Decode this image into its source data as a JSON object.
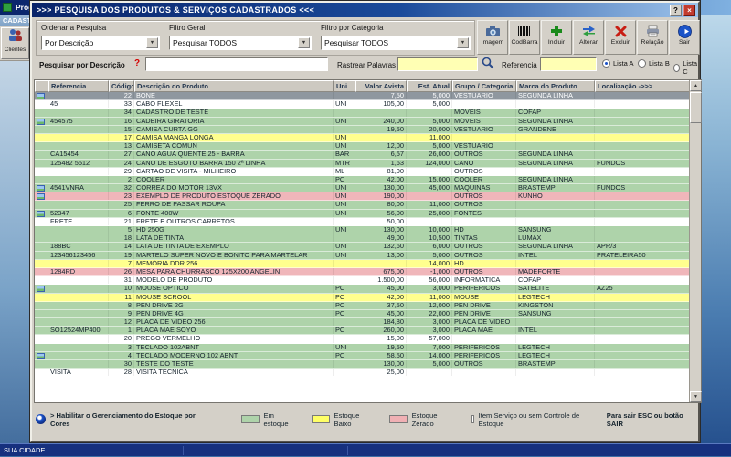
{
  "background": {
    "app_title": "Progra",
    "menu_label": "CADASTRO",
    "toolbar_button": "Clientes",
    "status_text": "SUA CIDADE"
  },
  "dialog": {
    "title": ">>>  PESQUISA DOS PRODUTOS & SERVIÇOS CADASTRADOS  <<<",
    "titlebar": {
      "help": "?",
      "close": "×"
    },
    "filters": {
      "order_label": "Ordenar a Pesquisa",
      "order_value": "Por Descrição",
      "general_label": "Filtro Geral",
      "general_value": "Pesquisar TODOS",
      "category_label": "Filtro por Categoria",
      "category_value": "Pesquisar TODOS"
    },
    "toolbar": [
      {
        "label": "Imagem",
        "icon": "camera-icon"
      },
      {
        "label": "CodBarra",
        "icon": "barcode-icon"
      },
      {
        "label": "Incluir",
        "icon": "plus-icon"
      },
      {
        "label": "Alterar",
        "icon": "edit-arrows-icon"
      },
      {
        "label": "Excluir",
        "icon": "x-icon"
      },
      {
        "label": "Relação",
        "icon": "report-icon"
      },
      {
        "label": "Sair",
        "icon": "exit-arrow-icon"
      }
    ],
    "search": {
      "desc_label": "Pesquisar por Descrição",
      "desc_hint": "?",
      "desc_value": "",
      "words_label": "Rastrear Palavras",
      "words_value": "",
      "ref_label": "Referencia",
      "ref_value": ""
    },
    "lists": [
      {
        "label": "Lista A",
        "selected": true
      },
      {
        "label": "Lista B",
        "selected": false
      },
      {
        "label": "Lista C",
        "selected": false
      }
    ],
    "table": {
      "headers": [
        "Referencia",
        "Código",
        "Descrição do Produto",
        "Uni",
        "Valor Avista",
        "Est. Atual",
        "Grupo / Categoria",
        "Marca do Produto",
        "Localização  ->>>"
      ],
      "status_colors": {
        "selected": "#8f979f",
        "ok": "#aed3aa",
        "low": "#ffff8e",
        "zero": "#f0b6ba",
        "none": "#ffffff"
      },
      "rows": [
        {
          "ref": "",
          "code": "22",
          "desc": "BONE",
          "uni": "",
          "price": "7,50",
          "stock": "5,000",
          "group": "VESTUARIO",
          "brand": "SEGUNDA LINHA",
          "loc": "",
          "status": "selected",
          "img": true
        },
        {
          "ref": "45",
          "code": "33",
          "desc": "CABO FLEXEL",
          "uni": "UNI",
          "price": "105,00",
          "stock": "5,000",
          "group": "",
          "brand": "",
          "loc": "",
          "status": "none",
          "img": false
        },
        {
          "ref": "",
          "code": "34",
          "desc": "CADASTRO DE TESTE",
          "uni": "",
          "price": "",
          "stock": "",
          "group": "MÓVEIS",
          "brand": "COFAP",
          "loc": "",
          "status": "ok",
          "img": false
        },
        {
          "ref": "454575",
          "code": "16",
          "desc": "CADEIRA GIRATORIA",
          "uni": "UNI",
          "price": "240,00",
          "stock": "5,000",
          "group": "MÓVEIS",
          "brand": "SEGUNDA LINHA",
          "loc": "",
          "status": "ok",
          "img": true
        },
        {
          "ref": "",
          "code": "15",
          "desc": "CAMISA CURTA GG",
          "uni": "",
          "price": "19,50",
          "stock": "20,000",
          "group": "VESTUARIO",
          "brand": "GRANDENE",
          "loc": "",
          "status": "ok",
          "img": false
        },
        {
          "ref": "",
          "code": "17",
          "desc": "CAMISA MANGA LONGA",
          "uni": "UNI",
          "price": "",
          "stock": "11,000",
          "group": "",
          "brand": "",
          "loc": "",
          "status": "low",
          "img": false
        },
        {
          "ref": "",
          "code": "13",
          "desc": "CAMISETA COMUN",
          "uni": "UNI",
          "price": "12,00",
          "stock": "5,000",
          "group": "VESTUARIO",
          "brand": "",
          "loc": "",
          "status": "ok",
          "img": false
        },
        {
          "ref": "CA15454",
          "code": "27",
          "desc": "CANO AGUA QUENTE 25 - BARRA",
          "uni": "BAR",
          "price": "6,57",
          "stock": "26,000",
          "group": "OUTROS",
          "brand": "SEGUNDA LINHA",
          "loc": "",
          "status": "ok",
          "img": false
        },
        {
          "ref": "125482 5512",
          "code": "24",
          "desc": "CANO DE ESGOTO BARRA 150 2ª LINHA",
          "uni": "MTR",
          "price": "1,63",
          "stock": "124,000",
          "group": "CANO",
          "brand": "SEGUNDA LINHA",
          "loc": "FUNDOS",
          "status": "ok",
          "img": false
        },
        {
          "ref": "",
          "code": "29",
          "desc": "CARTAO DE VISITA - MILHEIRO",
          "uni": "ML",
          "price": "81,00",
          "stock": "",
          "group": "OUTROS",
          "brand": "",
          "loc": "",
          "status": "none",
          "img": false
        },
        {
          "ref": "",
          "code": "2",
          "desc": "COOLER",
          "uni": "PC",
          "price": "42,00",
          "stock": "15,000",
          "group": "COOLER",
          "brand": "SEGUNDA LINHA",
          "loc": "",
          "status": "ok",
          "img": false
        },
        {
          "ref": "4541VNRA",
          "code": "32",
          "desc": "CORREA DO MOTOR 13VX",
          "uni": "UNI",
          "price": "130,00",
          "stock": "45,000",
          "group": "MAQUINAS",
          "brand": "BRASTEMP",
          "loc": "FUNDOS",
          "status": "ok",
          "img": true
        },
        {
          "ref": "",
          "code": "23",
          "desc": "EXEMPLO DE PRODUTO ESTOQUE ZERADO",
          "uni": "UNI",
          "price": "190,00",
          "stock": "",
          "group": "OUTROS",
          "brand": "KUNHO",
          "loc": "",
          "status": "zero",
          "img": true
        },
        {
          "ref": "",
          "code": "25",
          "desc": "FERRO DE PASSAR ROUPA",
          "uni": "UNI",
          "price": "80,00",
          "stock": "11,000",
          "group": "OUTROS",
          "brand": "",
          "loc": "",
          "status": "ok",
          "img": false
        },
        {
          "ref": "52347",
          "code": "6",
          "desc": "FONTE 400W",
          "uni": "UNI",
          "price": "56,00",
          "stock": "25,000",
          "group": "FONTES",
          "brand": "",
          "loc": "",
          "status": "ok",
          "img": true
        },
        {
          "ref": "FRETE",
          "code": "21",
          "desc": "FRETE E OUTROS CARRETOS",
          "uni": "",
          "price": "50,00",
          "stock": "",
          "group": "",
          "brand": "",
          "loc": "",
          "status": "none",
          "img": false
        },
        {
          "ref": "",
          "code": "5",
          "desc": "HD 250G",
          "uni": "UNI",
          "price": "130,00",
          "stock": "10,000",
          "group": "HD",
          "brand": "SANSUNG",
          "loc": "",
          "status": "ok",
          "img": false
        },
        {
          "ref": "",
          "code": "18",
          "desc": "LATA DE TINTA",
          "uni": "",
          "price": "49,00",
          "stock": "10,500",
          "group": "TINTAS",
          "brand": "LUMAX",
          "loc": "",
          "status": "ok",
          "img": false
        },
        {
          "ref": "188BC",
          "code": "14",
          "desc": "LATA DE TINTA DE EXEMPLO",
          "uni": "UNI",
          "price": "132,60",
          "stock": "6,000",
          "group": "OUTROS",
          "brand": "SEGUNDA LINHA",
          "loc": "APR/3",
          "status": "ok",
          "img": false
        },
        {
          "ref": "123456123456",
          "code": "19",
          "desc": "MARTELO SUPER NOVO E BONITO PARA MARTELAR",
          "uni": "UNI",
          "price": "13,00",
          "stock": "5,000",
          "group": "OUTROS",
          "brand": "INTEL",
          "loc": "PRATELEIRA50",
          "status": "ok",
          "img": false
        },
        {
          "ref": "",
          "code": "7",
          "desc": "MEMÓRIA DDR 256",
          "uni": "",
          "price": "",
          "stock": "14,000",
          "group": "HD",
          "brand": "",
          "loc": "",
          "status": "low",
          "img": false
        },
        {
          "ref": "1284RD",
          "code": "26",
          "desc": "MESA PARA CHURRASCO 125X200 ANGELIN",
          "uni": "",
          "price": "675,00",
          "stock": "-1,000",
          "group": "OUTROS",
          "brand": "MADEFORTE",
          "loc": "",
          "status": "zero",
          "img": false
        },
        {
          "ref": "",
          "code": "31",
          "desc": "MODELO DE PRODUTO",
          "uni": "",
          "price": "1.500,00",
          "stock": "56,000",
          "group": "INFORMATICA",
          "brand": "COFAP",
          "loc": "",
          "status": "none",
          "img": false
        },
        {
          "ref": "",
          "code": "10",
          "desc": "MOUSE OPTICO",
          "uni": "PC",
          "price": "45,00",
          "stock": "3,000",
          "group": "PERIFERICOS",
          "brand": "SATELITE",
          "loc": "AZ25",
          "status": "ok",
          "img": true
        },
        {
          "ref": "",
          "code": "11",
          "desc": "MOUSE SCROOL",
          "uni": "PC",
          "price": "42,00",
          "stock": "11,000",
          "group": "MOUSE",
          "brand": "LEGTECH",
          "loc": "",
          "status": "low",
          "img": false
        },
        {
          "ref": "",
          "code": "8",
          "desc": "PEN DRIVE 2G",
          "uni": "PC",
          "price": "37,50",
          "stock": "12,000",
          "group": "PEN DRIVE",
          "brand": "KINGSTON",
          "loc": "",
          "status": "ok",
          "img": false
        },
        {
          "ref": "",
          "code": "9",
          "desc": "PEN DRIVE 4G",
          "uni": "PC",
          "price": "45,00",
          "stock": "22,000",
          "group": "PEN DRIVE",
          "brand": "SANSUNG",
          "loc": "",
          "status": "ok",
          "img": false
        },
        {
          "ref": "",
          "code": "12",
          "desc": "PLACA DE VIDEO 256",
          "uni": "",
          "price": "184,80",
          "stock": "3,000",
          "group": "PLACA DE VIDEO",
          "brand": "",
          "loc": "",
          "status": "ok",
          "img": false
        },
        {
          "ref": "SO12524MP400",
          "code": "1",
          "desc": "PLACA MÃE SOYO",
          "uni": "PC",
          "price": "260,00",
          "stock": "3,000",
          "group": "PLACA MÃE",
          "brand": "INTEL",
          "loc": "",
          "status": "ok",
          "img": false
        },
        {
          "ref": "",
          "code": "20",
          "desc": "PREGO VERMELHO",
          "uni": "",
          "price": "15,00",
          "stock": "57,000",
          "group": "",
          "brand": "",
          "loc": "",
          "status": "none",
          "img": false
        },
        {
          "ref": "",
          "code": "3",
          "desc": "TECLADO 102ABNT",
          "uni": "UNI",
          "price": "19,50",
          "stock": "7,000",
          "group": "PERIFERICOS",
          "brand": "LEGTECH",
          "loc": "",
          "status": "ok",
          "img": false
        },
        {
          "ref": "",
          "code": "4",
          "desc": "TECLADO MODERNO 102 ABNT",
          "uni": "PC",
          "price": "58,50",
          "stock": "14,000",
          "group": "PERIFERICOS",
          "brand": "LEGTECH",
          "loc": "",
          "status": "ok",
          "img": true
        },
        {
          "ref": "",
          "code": "30",
          "desc": "TESTE DO TESTE",
          "uni": "",
          "price": "130,00",
          "stock": "5,000",
          "group": "OUTROS",
          "brand": "BRASTEMP",
          "loc": "",
          "status": "ok",
          "img": false
        },
        {
          "ref": "VISITA",
          "code": "28",
          "desc": "VISITA TECNICA",
          "uni": "",
          "price": "25,00",
          "stock": "",
          "group": "",
          "brand": "",
          "loc": "",
          "status": "none",
          "img": false
        }
      ]
    },
    "legend": {
      "toggle_label": "> Habilitar o Gerenciamento do Estoque por Cores",
      "items": [
        {
          "label": "Em estoque",
          "color": "#aed3aa"
        },
        {
          "label": "Estoque Baixo",
          "color": "#ffff66"
        },
        {
          "label": "Estoque Zerado",
          "color": "#f0b0b4"
        },
        {
          "label": "Item Serviço ou sem Controle de Estoque",
          "color": "#ffffff"
        }
      ],
      "exit_hint": "Para sair ESC ou botão SAIR"
    }
  }
}
